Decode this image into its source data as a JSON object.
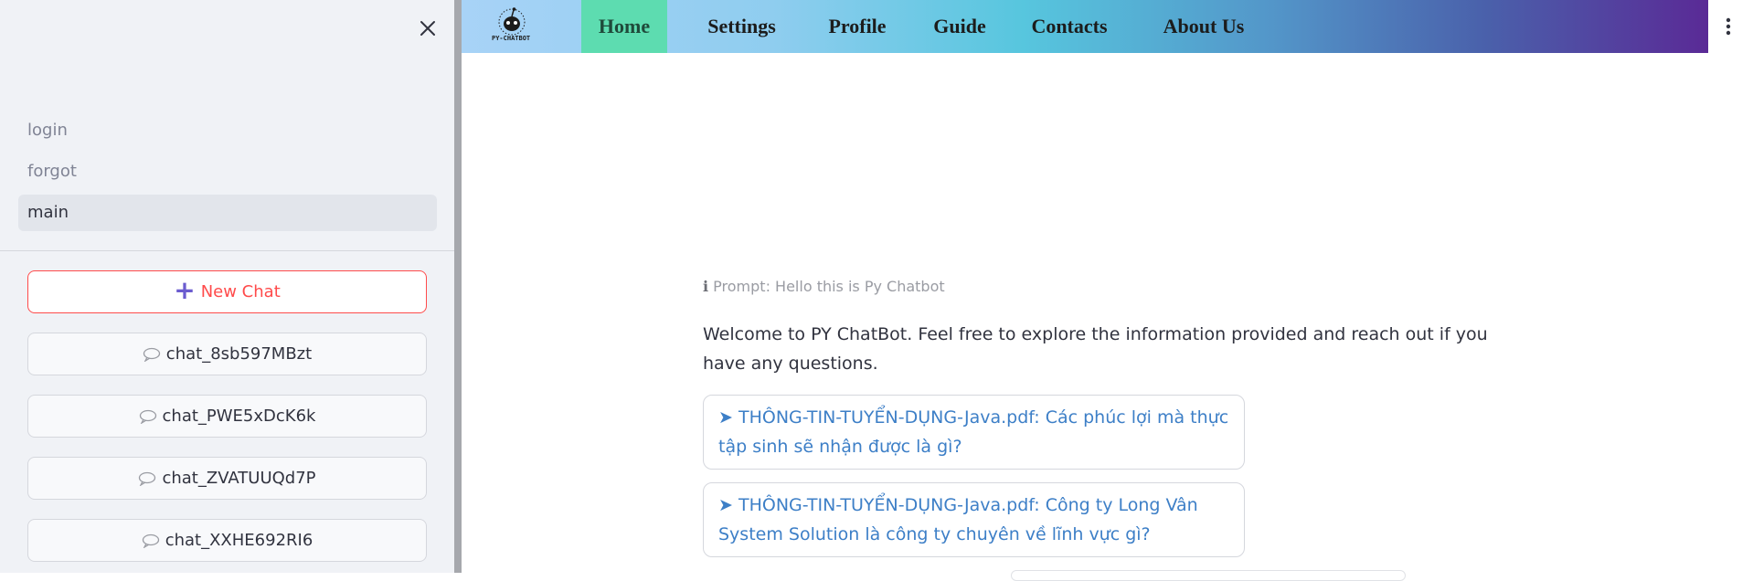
{
  "sidebar": {
    "nav": [
      {
        "label": "login"
      },
      {
        "label": "forgot"
      },
      {
        "label": "main"
      }
    ],
    "new_chat_label": "New Chat",
    "chats": [
      {
        "label": "chat_8sb597MBzt"
      },
      {
        "label": "chat_PWE5xDcK6k"
      },
      {
        "label": "chat_ZVATUUQd7P"
      },
      {
        "label": "chat_XXHE692RI6"
      }
    ]
  },
  "navbar": {
    "logo_text": "PY-CHATBOT",
    "items": [
      {
        "label": "Home"
      },
      {
        "label": "Settings"
      },
      {
        "label": "Profile"
      },
      {
        "label": "Guide"
      },
      {
        "label": "Contacts"
      },
      {
        "label": "About Us"
      }
    ],
    "active": "Home"
  },
  "main": {
    "prompt_label": "Prompt: Hello this is Py Chatbot",
    "welcome": "Welcome to PY ChatBot. Feel free to explore the information provided and reach out if you have any questions.",
    "suggestions": [
      {
        "text": "THÔNG-TIN-TUYỂN-DỤNG-Java.pdf: Các phúc lợi mà thực tập sinh sẽ nhận được là gì?"
      },
      {
        "text": "THÔNG-TIN-TUYỂN-DỤNG-Java.pdf: Công ty Long Vân System Solution là công ty chuyên về lĩnh vực gì?"
      }
    ]
  },
  "icons": {
    "close": "close-icon",
    "plus": "plus-icon",
    "chat": "speech-bubble-icon",
    "menu": "kebab-menu-icon",
    "info": "info-icon",
    "arrow": "arrow-right-icon"
  },
  "colors": {
    "accent_red": "#ff4b4b",
    "active_tab": "#5ddcb0",
    "link_blue": "#3d7fc7"
  }
}
